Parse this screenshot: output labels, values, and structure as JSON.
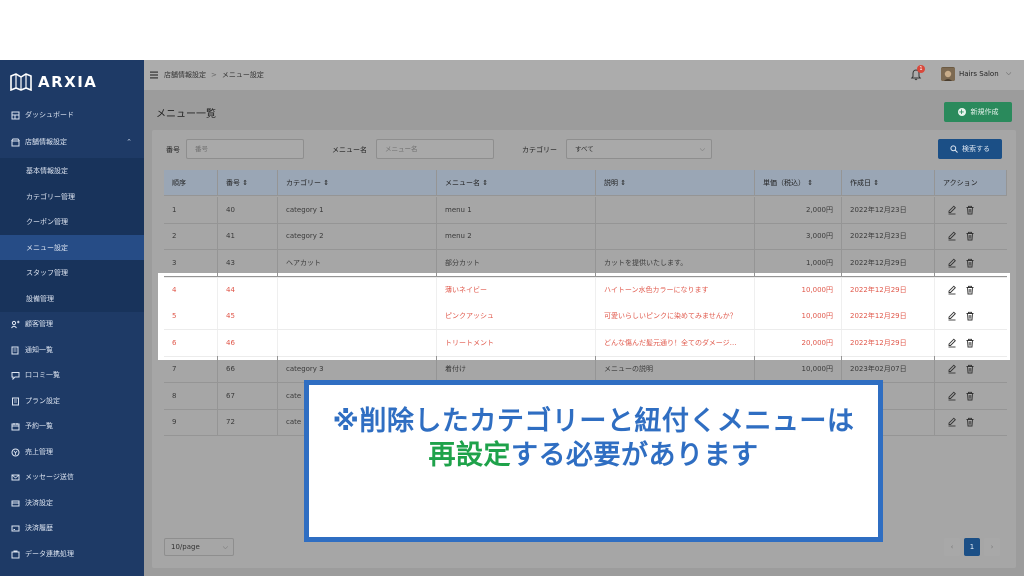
{
  "brand": {
    "name": "ARXIA"
  },
  "sidebar": {
    "items": [
      {
        "label": "ダッシュボード",
        "icon": "dashboard-icon"
      },
      {
        "label": "店舗情報設定",
        "icon": "store-icon",
        "expanded": true
      },
      {
        "label": "基本情報設定",
        "sub": true
      },
      {
        "label": "カテゴリー管理",
        "sub": true
      },
      {
        "label": "クーポン管理",
        "sub": true
      },
      {
        "label": "メニュー設定",
        "sub": true,
        "active": true
      },
      {
        "label": "スタッフ管理",
        "sub": true
      },
      {
        "label": "設備管理",
        "sub": true
      },
      {
        "label": "顧客管理",
        "icon": "customers-icon"
      },
      {
        "label": "通知一覧",
        "icon": "notice-icon"
      },
      {
        "label": "口コミ一覧",
        "icon": "review-icon"
      },
      {
        "label": "プラン設定",
        "icon": "plan-icon"
      },
      {
        "label": "予約一覧",
        "icon": "calendar-icon"
      },
      {
        "label": "売上管理",
        "icon": "sales-icon"
      },
      {
        "label": "メッセージ送信",
        "icon": "message-icon"
      },
      {
        "label": "決済設定",
        "icon": "payment-icon"
      },
      {
        "label": "決済履歴",
        "icon": "history-icon"
      },
      {
        "label": "データ連携処理",
        "icon": "data-icon"
      }
    ]
  },
  "topbar": {
    "breadcrumb": [
      "店舗情報設定",
      "メニュー設定"
    ],
    "notification_count": "1",
    "user_name": "Hairs Salon"
  },
  "page": {
    "title": "メニュー一覧",
    "new_button": "新規作成"
  },
  "filters": {
    "number_label": "番号",
    "number_placeholder": "番号",
    "menu_label": "メニュー名",
    "menu_placeholder": "メニュー名",
    "category_label": "カテゴリー",
    "category_value": "すべて",
    "search_button": "検索する"
  },
  "table": {
    "headers": [
      "順序",
      "番号 ⇕",
      "カテゴリー ⇕",
      "メニュー名 ⇕",
      "説明 ⇕",
      "単価（税込） ⇕",
      "作成日 ⇕",
      "アクション"
    ],
    "rows": [
      [
        "1",
        "40",
        "category 1",
        "menu 1",
        "",
        "2,000円",
        "2022年12月23日"
      ],
      [
        "2",
        "41",
        "category 2",
        "menu 2",
        "",
        "3,000円",
        "2022年12月23日"
      ],
      [
        "3",
        "43",
        "ヘアカット",
        "部分カット",
        "カットを提供いたします。",
        "1,000円",
        "2022年12月29日"
      ],
      [
        "4",
        "44",
        "",
        "薄いネイビー",
        "ハイトーン水色カラーになります",
        "10,000円",
        "2022年12月29日"
      ],
      [
        "5",
        "45",
        "",
        "ピンクアッシュ",
        "可愛いらしいピンクに染めてみませんか？",
        "10,000円",
        "2022年12月29日"
      ],
      [
        "6",
        "46",
        "",
        "トリートメント",
        "どんな傷んだ髪元通り！全てのダメージ…",
        "20,000円",
        "2022年12月29日"
      ],
      [
        "7",
        "66",
        "category 3",
        "着付け",
        "メニューの説明",
        "10,000円",
        "2023年02月07日"
      ],
      [
        "8",
        "67",
        "cate",
        "",
        "",
        "",
        "2月07日"
      ],
      [
        "9",
        "72",
        "cate",
        "",
        "",
        "",
        "2月10日"
      ]
    ],
    "highlighted_rows": [
      3,
      4,
      5
    ]
  },
  "pagination": {
    "page_size": "10/page",
    "current_page": "1"
  },
  "callout": {
    "line1": "※削除したカテゴリーと紐付くメニューは",
    "line2_green": "再設定",
    "line2_blue": "する必要があります"
  },
  "colors": {
    "sidebar": "#1e3a66",
    "new_button": "#2a8a5c",
    "search_button": "#1b4f86",
    "highlight_text": "#e0584b",
    "callout_blue": "#2f6ec2",
    "callout_green": "#1ea24a"
  }
}
